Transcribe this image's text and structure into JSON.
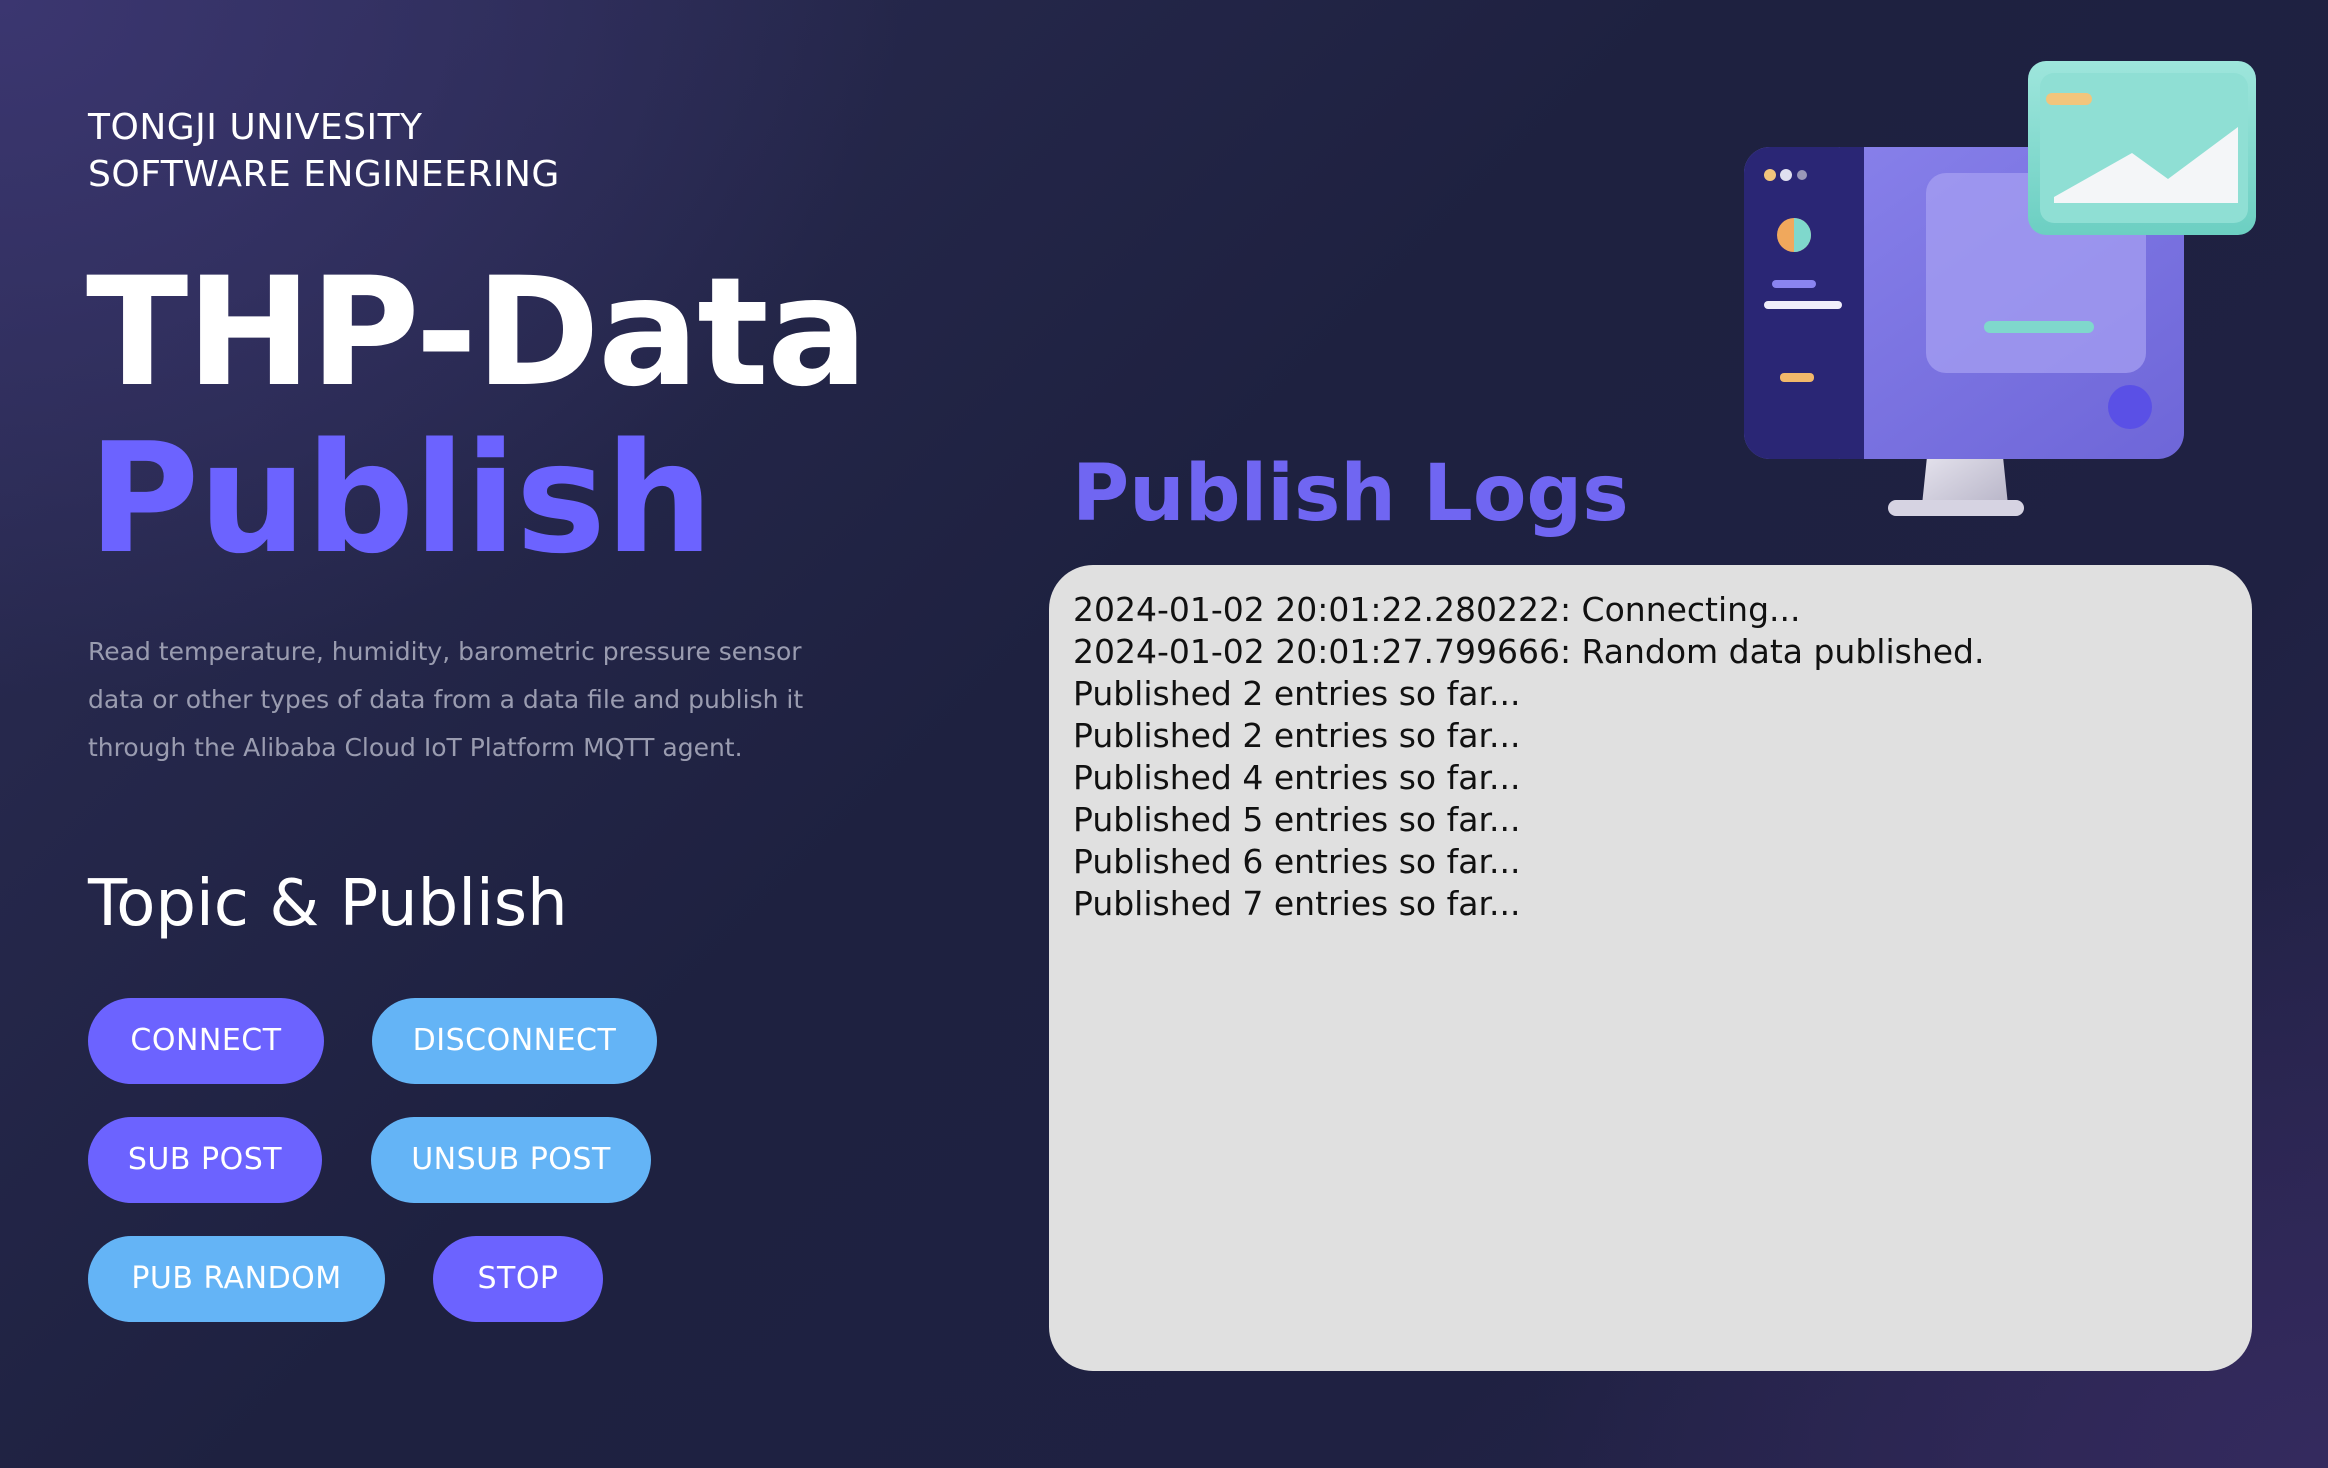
{
  "header": {
    "institution_line1": "TONGJI UNIVESITY",
    "institution_line2": "SOFTWARE ENGINEERING"
  },
  "hero": {
    "title": "THP-Data",
    "subtitle": "Publish",
    "description": "Read temperature, humidity, barometric pressure sensor data or other types of data from a data file and publish it through the Alibaba Cloud IoT Platform MQTT agent."
  },
  "controls": {
    "heading": "Topic & Publish",
    "connect": "CONNECT",
    "disconnect": "DISCONNECT",
    "sub_post": "SUB POST",
    "unsub_post": "UNSUB POST",
    "pub_random": "PUB RANDOM",
    "stop": "STOP"
  },
  "logs": {
    "heading": "Publish Logs",
    "lines": [
      "2024-01-02 20:01:22.280222: Connecting...",
      "2024-01-02 20:01:27.799666: Random data published.",
      "Published 2 entries so far...",
      "Published 2 entries so far...",
      "Published 4 entries so far...",
      "Published 5 entries so far...",
      "Published 6 entries so far...",
      "Published 7 entries so far..."
    ]
  },
  "colors": {
    "accent_purple": "#6c63ff",
    "accent_blue": "#64b4f6",
    "background_dark": "#1e2140",
    "log_panel": "#e0e0e0"
  },
  "icons": {
    "illustration": "monitor-illustration-icon"
  }
}
